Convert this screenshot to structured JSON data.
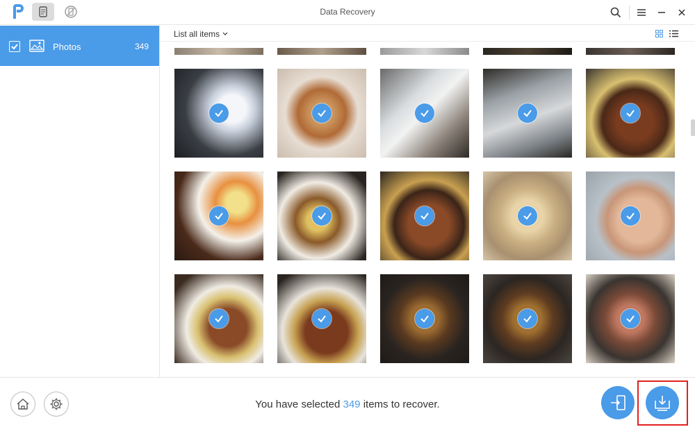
{
  "window": {
    "title": "Data Recovery"
  },
  "titlebar": {
    "logo_icon": "phonerescue-logo-icon",
    "mode_buttons": [
      {
        "name": "device-mode-icon",
        "active": true
      },
      {
        "name": "backup-mode-icon",
        "active": false
      }
    ],
    "right_icons": [
      "search-icon",
      "menu-icon",
      "minimize-icon",
      "close-icon"
    ]
  },
  "sidebar": {
    "items": [
      {
        "label": "Photos",
        "count": "349",
        "checked": true,
        "icon": "image-icon"
      }
    ]
  },
  "toolbar": {
    "list_all_label": "List all items",
    "views": [
      "grid-view-icon",
      "list-view-icon"
    ]
  },
  "photos": {
    "selected_all": true,
    "rows": [
      [
        "partial",
        "partial",
        "partial",
        "partial",
        "partial"
      ],
      [
        "credit-card",
        "tofu-dish",
        "jar",
        "papers",
        "grill"
      ],
      [
        "dinner-table",
        "dinner-plate",
        "grill",
        "dumplings",
        "baby"
      ],
      [
        "grill-table",
        "grill-chopsticks",
        "grill",
        "grill",
        "grill-meat"
      ]
    ]
  },
  "bottombar": {
    "status_prefix": "You have selected",
    "selected_count": "349",
    "status_suffix": "items to recover.",
    "left_icons": [
      "home-icon",
      "settings-icon"
    ],
    "actions": [
      "to-device-icon",
      "to-computer-icon"
    ]
  },
  "colors": {
    "accent": "#4a9be8",
    "highlight": "#e02020"
  }
}
